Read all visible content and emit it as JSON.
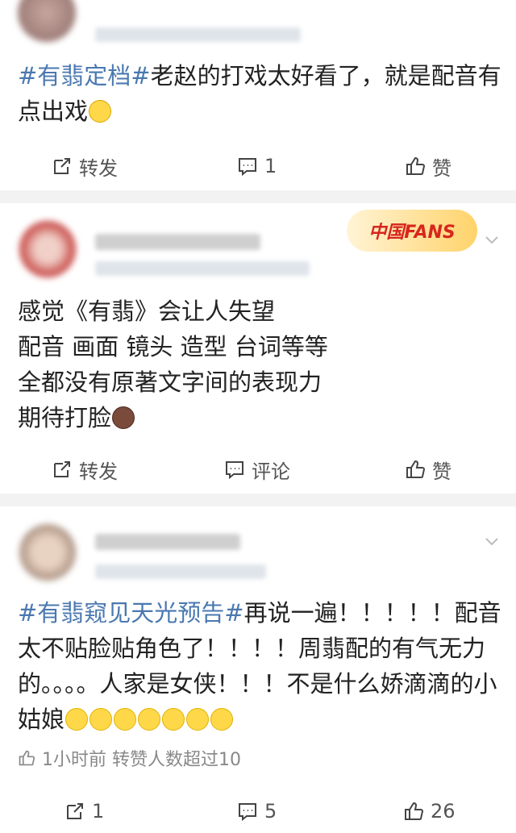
{
  "post1": {
    "topic": "#有翡定档#",
    "text": "老赵的打戏太好看了，就是配音有点出戏",
    "emoji": "crying-face",
    "actions": {
      "repost": "转发",
      "comment": "1",
      "like": "赞"
    }
  },
  "post2": {
    "badge": "中国FANS",
    "lines": [
      "感觉《有翡》会让人失望",
      "配音 画面 镜头 造型 台词等等",
      "全都没有原著文字间的表现力",
      "期待打脸"
    ],
    "emoji": "face-emoji",
    "actions": {
      "repost": "转发",
      "comment": "评论",
      "like": "赞"
    }
  },
  "post3": {
    "topic": "#有翡窥见天光预告#",
    "text": "再说一遍！！！！！配音太不贴脸贴角色了！！！！周翡配的有气无力的。。。。人家是女侠！！！不是什么娇滴滴的小姑娘",
    "smiles": [
      "smile-emoji",
      "smile-emoji",
      "smile-emoji",
      "smile-emoji",
      "smile-emoji",
      "smile-emoji",
      "smile-emoji"
    ],
    "meta": "1小时前 转赞人数超过10",
    "actions": {
      "repost": "1",
      "comment": "5",
      "like": "26"
    }
  },
  "colors": {
    "topic": "#4a78b0",
    "background": "#f2f2f2"
  }
}
